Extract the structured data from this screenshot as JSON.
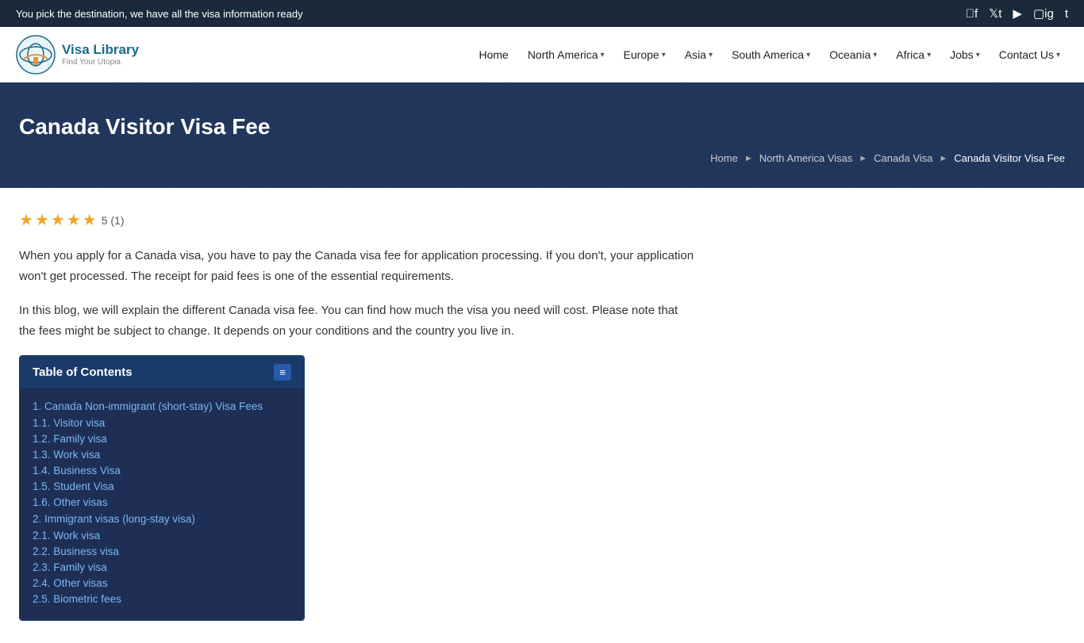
{
  "topbar": {
    "tagline": "You pick the destination, we have all the visa information ready",
    "social_icons": [
      "facebook",
      "twitter",
      "youtube",
      "instagram",
      "tumblr"
    ]
  },
  "nav": {
    "logo_title": "Visa Library",
    "logo_subtitle": "Find Your Utopia",
    "items": [
      {
        "label": "Home",
        "has_dropdown": false
      },
      {
        "label": "North America",
        "has_dropdown": true
      },
      {
        "label": "Europe",
        "has_dropdown": true
      },
      {
        "label": "Asia",
        "has_dropdown": true
      },
      {
        "label": "South America",
        "has_dropdown": true
      },
      {
        "label": "Oceania",
        "has_dropdown": true
      },
      {
        "label": "Africa",
        "has_dropdown": true
      },
      {
        "label": "Jobs",
        "has_dropdown": true
      },
      {
        "label": "Contact Us",
        "has_dropdown": true
      }
    ]
  },
  "hero": {
    "title": "Canada Visitor Visa Fee",
    "breadcrumb": [
      {
        "label": "Home",
        "link": true
      },
      {
        "label": "North America Visas",
        "link": true
      },
      {
        "label": "Canada Visa",
        "link": true
      },
      {
        "label": "Canada Visitor Visa Fee",
        "link": false
      }
    ]
  },
  "rating": {
    "stars": 5,
    "score": "5",
    "count": "(1)"
  },
  "article": {
    "para1": "When you apply for a Canada visa, you have to pay the Canada visa fee for application processing. If you don't, your application won't get processed. The receipt for paid fees is one of the essential requirements.",
    "para2": "In this blog, we will explain the different Canada visa fee. You can find how much the visa you need will cost. Please note that the fees might be subject to change. It depends on your conditions and the country you live in."
  },
  "toc": {
    "title": "Table of Contents",
    "toggle_label": "≡",
    "sections": [
      {
        "number": "1",
        "label": "Canada Non-immigrant (short-stay) Visa Fees",
        "sub_items": [
          {
            "number": "1.1",
            "label": "Visitor visa"
          },
          {
            "number": "1.2",
            "label": "Family visa"
          },
          {
            "number": "1.3",
            "label": "Work visa"
          },
          {
            "number": "1.4",
            "label": "Business Visa"
          },
          {
            "number": "1.5",
            "label": "Student Visa"
          },
          {
            "number": "1.6",
            "label": "Other visas"
          }
        ]
      },
      {
        "number": "2",
        "label": "Immigrant visas (long-stay visa)",
        "sub_items": [
          {
            "number": "2.1",
            "label": "Work visa"
          },
          {
            "number": "2.2",
            "label": "Business visa"
          },
          {
            "number": "2.3",
            "label": "Family visa"
          },
          {
            "number": "2.4",
            "label": "Other visas"
          },
          {
            "number": "2.5",
            "label": "Biometric fees"
          }
        ]
      }
    ]
  }
}
